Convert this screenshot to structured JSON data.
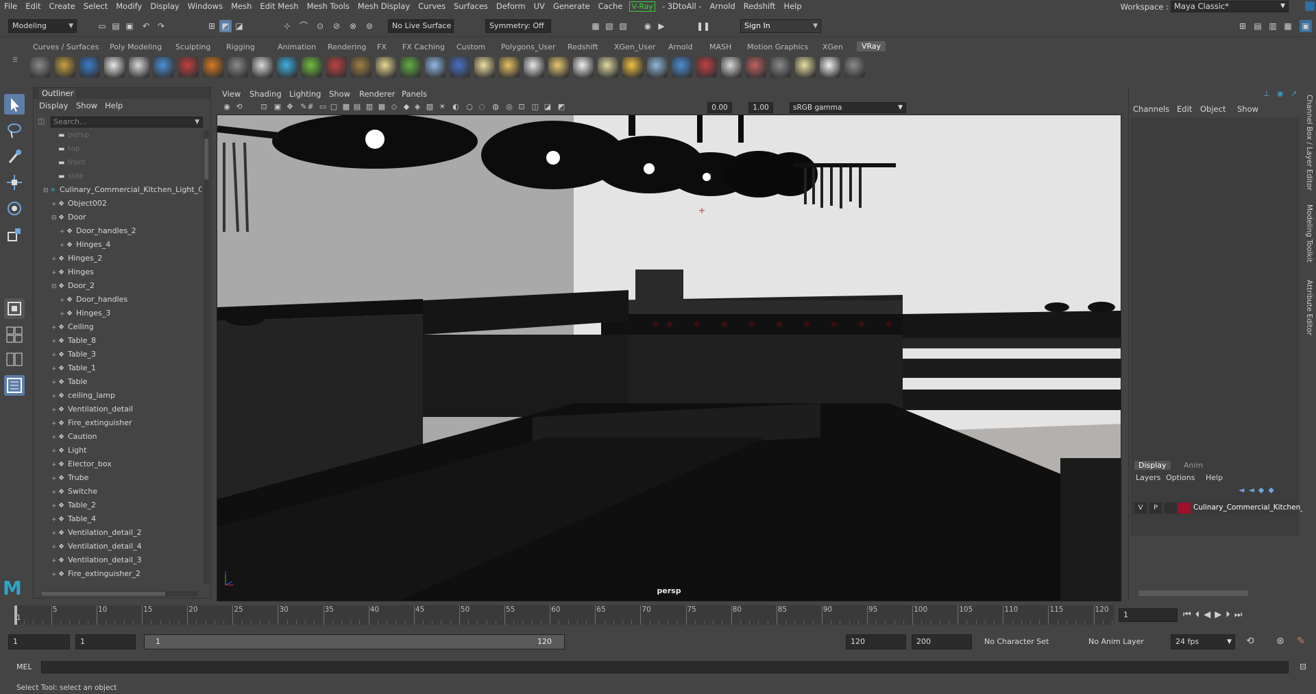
{
  "menubar": {
    "items": [
      "File",
      "Edit",
      "Create",
      "Select",
      "Modify",
      "Display",
      "Windows",
      "Mesh",
      "Edit Mesh",
      "Mesh Tools",
      "Mesh Display",
      "Curves",
      "Surfaces",
      "Deform",
      "UV",
      "Generate",
      "Cache"
    ],
    "vray": "V-Ray",
    "items2": [
      "- 3DtoAll -",
      "Arnold",
      "Redshift",
      "Help"
    ],
    "workspace_label": "Workspace :",
    "workspace_value": "Maya Classic*"
  },
  "statusline": {
    "mode": "Modeling",
    "live_surface": "No Live Surface",
    "symmetry": "Symmetry: Off",
    "sign_in": "Sign In"
  },
  "shelf": {
    "tabs": [
      "Curves / Surfaces",
      "Poly Modeling",
      "Sculpting",
      "Rigging",
      "Animation",
      "Rendering",
      "FX",
      "FX Caching",
      "Custom",
      "Polygons_User",
      "Redshift",
      "XGen_User",
      "Arnold",
      "MASH",
      "Motion Graphics",
      "XGen",
      "VRay"
    ],
    "active_tab": "VRay"
  },
  "outliner": {
    "title": "Outliner",
    "menu": [
      "Display",
      "Show",
      "Help"
    ],
    "search_placeholder": "Search...",
    "items": [
      {
        "label": "persp",
        "kind": "camera",
        "indent": 0
      },
      {
        "label": "top",
        "kind": "camera",
        "indent": 0
      },
      {
        "label": "front",
        "kind": "camera",
        "indent": 0
      },
      {
        "label": "side",
        "kind": "camera",
        "indent": 0
      },
      {
        "label": "Culinary_Commercial_Kitchen_Light_C",
        "kind": "root",
        "indent": 0
      },
      {
        "label": "Object002",
        "kind": "mesh",
        "indent": 1
      },
      {
        "label": "Door",
        "kind": "group",
        "indent": 1
      },
      {
        "label": "Door_handles_2",
        "kind": "mesh",
        "indent": 2
      },
      {
        "label": "Hinges_4",
        "kind": "mesh",
        "indent": 2
      },
      {
        "label": "Hinges_2",
        "kind": "mesh",
        "indent": 1
      },
      {
        "label": "Hinges",
        "kind": "mesh",
        "indent": 1
      },
      {
        "label": "Door_2",
        "kind": "group",
        "indent": 1
      },
      {
        "label": "Door_handles",
        "kind": "mesh",
        "indent": 2
      },
      {
        "label": "Hinges_3",
        "kind": "mesh",
        "indent": 2
      },
      {
        "label": "Ceiling",
        "kind": "mesh",
        "indent": 1
      },
      {
        "label": "Table_8",
        "kind": "mesh",
        "indent": 1
      },
      {
        "label": "Table_3",
        "kind": "mesh",
        "indent": 1
      },
      {
        "label": "Table_1",
        "kind": "mesh",
        "indent": 1
      },
      {
        "label": "Table",
        "kind": "mesh",
        "indent": 1
      },
      {
        "label": "ceiling_lamp",
        "kind": "mesh",
        "indent": 1
      },
      {
        "label": "Ventilation_detail",
        "kind": "mesh",
        "indent": 1
      },
      {
        "label": "Fire_extinguisher",
        "kind": "mesh",
        "indent": 1
      },
      {
        "label": "Caution",
        "kind": "mesh",
        "indent": 1
      },
      {
        "label": "Light",
        "kind": "mesh",
        "indent": 1
      },
      {
        "label": "Elector_box",
        "kind": "mesh",
        "indent": 1
      },
      {
        "label": "Trube",
        "kind": "mesh",
        "indent": 1
      },
      {
        "label": "Switche",
        "kind": "mesh",
        "indent": 1
      },
      {
        "label": "Table_2",
        "kind": "mesh",
        "indent": 1
      },
      {
        "label": "Table_4",
        "kind": "mesh",
        "indent": 1
      },
      {
        "label": "Ventilation_detail_2",
        "kind": "mesh",
        "indent": 1
      },
      {
        "label": "Ventilation_detail_4",
        "kind": "mesh",
        "indent": 1
      },
      {
        "label": "Ventilation_detail_3",
        "kind": "mesh",
        "indent": 1
      },
      {
        "label": "Fire_extinguisher_2",
        "kind": "mesh",
        "indent": 1
      }
    ]
  },
  "viewport": {
    "menu": [
      "View",
      "Shading",
      "Lighting",
      "Show",
      "Renderer",
      "Panels"
    ],
    "exposure": "0.00",
    "gamma": "1.00",
    "color_space": "sRGB gamma",
    "camera_label": "persp"
  },
  "channelbox": {
    "menu": [
      "Channels",
      "Edit",
      "Object",
      "Show"
    ],
    "layer_tabs": [
      "Display",
      "Anim"
    ],
    "layer_menu": [
      "Layers",
      "Options",
      "Help"
    ],
    "layer": {
      "v": "V",
      "p": "P",
      "name": "Culinary_Commercial_Kitchen_",
      "color": "#a0102a"
    },
    "side_tabs": [
      "Channel Box / Layer Editor",
      "Modeling Toolkit",
      "Attribute Editor"
    ]
  },
  "timeline": {
    "ticks": [
      "5",
      "10",
      "15",
      "20",
      "25",
      "30",
      "35",
      "40",
      "45",
      "50",
      "55",
      "60",
      "65",
      "70",
      "75",
      "80",
      "85",
      "90",
      "95",
      "100",
      "105",
      "110",
      "115",
      "120"
    ],
    "first_tick": "1",
    "current_frame": "1"
  },
  "range": {
    "start": "1",
    "playback_start": "1",
    "range_start": "1",
    "range_end": "120",
    "end": "120",
    "anim_end": "200",
    "character_set": "No Character Set",
    "anim_layer": "No Anim Layer",
    "fps": "24 fps"
  },
  "cmdline": {
    "label": "MEL"
  },
  "status": {
    "text": "Select Tool: select an object"
  }
}
